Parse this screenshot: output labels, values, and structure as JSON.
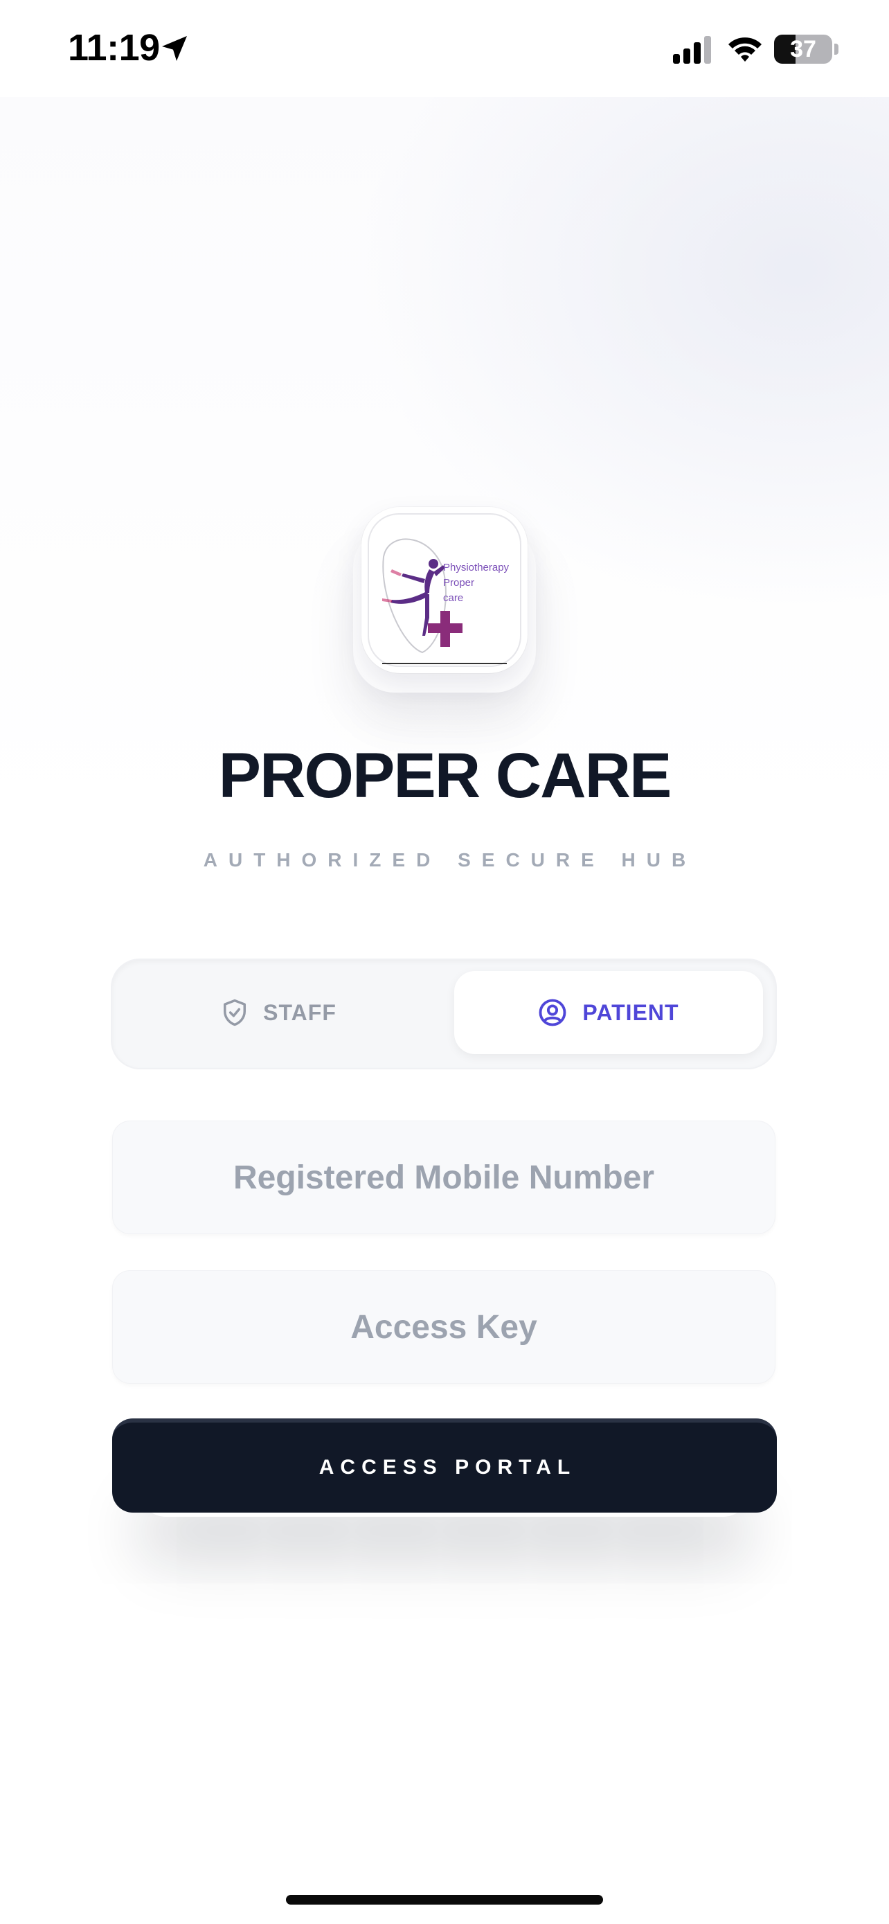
{
  "status_bar": {
    "time": "11:19",
    "battery_level": "37",
    "icons": [
      "location-arrow-icon",
      "cellular-signal-icon",
      "wifi-icon",
      "battery-icon"
    ]
  },
  "logo": {
    "lines": [
      "Physiotherapy",
      "Proper",
      "care"
    ],
    "icon": "dancer-cross-logo",
    "colors": {
      "purple": "#5b2d86",
      "magenta": "#8a2c7a",
      "violet": "#7b4fb8"
    }
  },
  "header": {
    "title": "PROPER CARE",
    "subtitle": "AUTHORIZED SECURE HUB"
  },
  "role_toggle": {
    "options": [
      {
        "label": "STAFF",
        "icon": "shield-check-icon",
        "selected": false
      },
      {
        "label": "PATIENT",
        "icon": "user-circle-icon",
        "selected": true
      }
    ]
  },
  "form": {
    "mobile_placeholder": "Registered Mobile Number",
    "mobile_value": "",
    "key_placeholder": "Access Key",
    "key_value": "",
    "submit_label": "ACCESS PORTAL"
  },
  "theme": {
    "primary_dark": "#111827",
    "accent_indigo": "#4f46d8",
    "muted_gray": "#9ca3af"
  }
}
